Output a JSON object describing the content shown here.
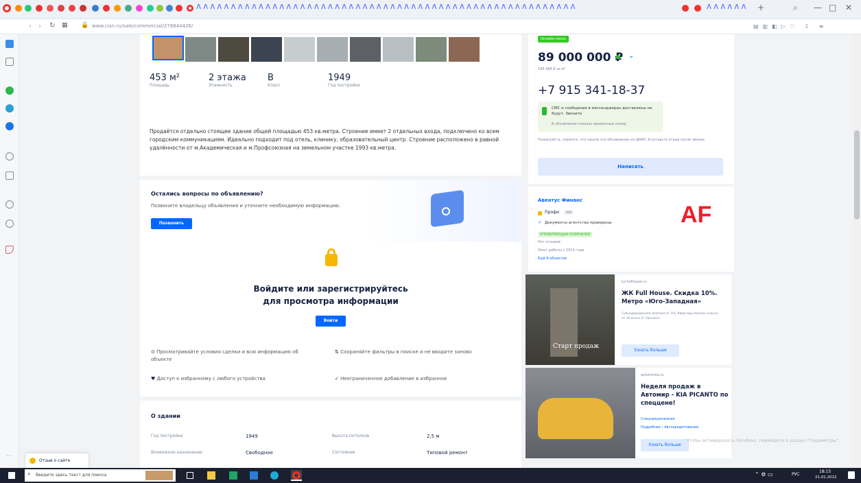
{
  "browser": {
    "url": "www.cian.ru/sale/commercial/276844426/",
    "window_controls": [
      "—",
      "□",
      "✕"
    ]
  },
  "gallery": {
    "count": 10
  },
  "stats": [
    {
      "value": "453 м²",
      "label": "Площадь"
    },
    {
      "value": "2 этажа",
      "label": "Этажность"
    },
    {
      "value": "B",
      "label": "Класс"
    },
    {
      "value": "1949",
      "label": "Год постройки"
    }
  ],
  "description": "Продаётся отдельно стоящее здание общей площадью 453 кв.метра. Строение имеет 2 отдельных входа, подключено ко всем городским коммуникациям. Идеально подходит под отель, клинику, образовательный центр. Строение расположено в равной удалённости от м.Академическая и м.Профсоюзная на земельном участке 1993 кв.метра.",
  "questions": {
    "title": "Остались вопросы по объявлению?",
    "subtitle": "Позвоните владельцу объявления и уточните необходимую информацию.",
    "button": "Позвонить"
  },
  "login": {
    "title_line1": "Войдите или зарегистрируйтесь",
    "title_line2": "для просмотра информации",
    "button": "Войти",
    "benefits": [
      "Просматривайте условия сделки и всю информацию об объекте",
      "Сохраняйте фильтры в поиске и не вводите заново",
      "Доступ к избранному с любого устройства",
      "Неограниченное добавление в избранное"
    ]
  },
  "about": {
    "title": "О здании",
    "rows": [
      {
        "k1": "Год постройки",
        "v1": "1949",
        "k2": "Высота потолков",
        "v2": "2,5 м"
      },
      {
        "k1": "Возможное назначение",
        "v1": "Свободное",
        "k2": "Состояние",
        "v2": "Типовой ремонт"
      }
    ]
  },
  "price": {
    "badge": "Онлайн-показ",
    "value": "89 000 000 ₽",
    "per_m": "196 468 ₽ за м²",
    "phone": "+7 915 341-18-37",
    "sms_note": "СМС и сообщения в мессенджерах доставлены не будут. Звоните",
    "sms_note2": "В объявлении показан временный номер",
    "report": "Пожалуйста, скажите, что нашли это объявление на ЦИАН. И оставьте отзыв после звонка",
    "write_btn": "Написать"
  },
  "agency": {
    "name": "Авентус Финанс",
    "pro": "Профи",
    "pro_count": "360",
    "verified": "Документы агентства проверены",
    "tag": "УПРАВЛЯЮЩАЯ КОМПАНИЯ",
    "reviews": "Нет отзывов",
    "experience": "Опыт работы с 2015 года",
    "more": "Ещё 8 объектов",
    "logo": "AF"
  },
  "ad1": {
    "domain": "kz-fullhouse.ru",
    "title": "ЖК Full House. Скидка 10%. Метро «Юго-Западная»",
    "text": "Субсидированная ипотека от 3%. Квартиры бизнес-класса от 30,8 млн ₽. Звоните!",
    "button": "Узнать больше",
    "img_text": "Старт продаж"
  },
  "ad2": {
    "domain": "avtomirkia.ru",
    "title": "Неделя продаж в Автомир - KIA PICANTO по спеццене!",
    "text": "Спецпредложения",
    "text2": "Подробнее › Автокредитования",
    "button": "Узнать больше"
  },
  "feedback": {
    "label": "Отзыв о сайте"
  },
  "windows_note": "Чтобы активировать Windows, перейдите в раздел \"Параметры\".",
  "taskbar": {
    "search": "Введите здесь текст для поиска",
    "time": "18:15",
    "date": "21.01.2022",
    "lang": "РУС"
  }
}
